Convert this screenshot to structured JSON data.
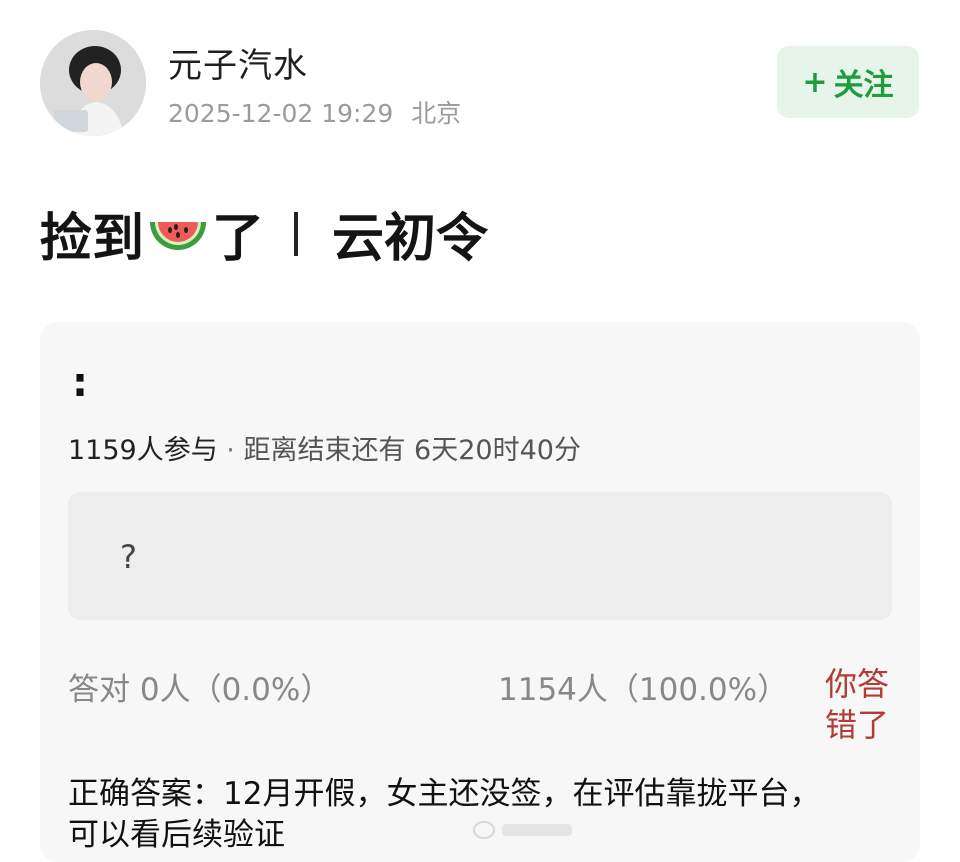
{
  "author": {
    "name": "元子汽水",
    "timestamp": "2025-12-02 19:29",
    "location": "北京",
    "avatar_icon": "avatar-photo"
  },
  "follow_button": {
    "plus": "+",
    "label": "关注"
  },
  "post": {
    "title_part1": "捡到",
    "title_emoji": "watermelon-emoji",
    "title_part2": "了",
    "title_part3": "云初令"
  },
  "quiz": {
    "question_marker": ":",
    "participants": "1159人参与",
    "separator": " · ",
    "countdown": "距离结束还有 6天20时40分",
    "option_text": "?",
    "correct_stat": "答对  0人（0.0%）",
    "wrong_stat": "1154人（100.0%）",
    "result_badge": "你答错了",
    "answer": "正确答案：12月开假，女主还没签，在评估靠拢平台，可以看后续验证"
  },
  "colors": {
    "follow_bg": "#e6f4ea",
    "follow_text": "#1f9c3f",
    "wrong_text": "#b13b36"
  }
}
